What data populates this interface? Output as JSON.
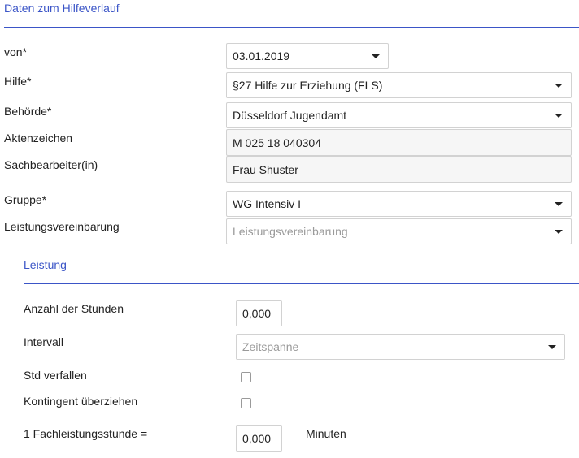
{
  "section": {
    "title": "Daten zum Hilfeverlauf"
  },
  "fields": {
    "von": {
      "label": "von*",
      "value": "03.01.2019"
    },
    "hilfe": {
      "label": "Hilfe*",
      "value": "§27 Hilfe zur Erziehung (FLS)"
    },
    "behoerde": {
      "label": "Behörde*",
      "value": "Düsseldorf Jugendamt"
    },
    "aktenzeichen": {
      "label": "Aktenzeichen",
      "value": "M 025 18 040304"
    },
    "sachbearbeiter": {
      "label": "Sachbearbeiter(in)",
      "value": "Frau Shuster"
    },
    "gruppe": {
      "label": "Gruppe*",
      "value": "WG Intensiv I"
    },
    "leistungsvereinbarung": {
      "label": "Leistungsvereinbarung",
      "placeholder": "Leistungsvereinbarung"
    }
  },
  "leistung": {
    "title": "Leistung",
    "anzahl_stunden": {
      "label": "Anzahl der Stunden",
      "value": "0,000"
    },
    "intervall": {
      "label": "Intervall",
      "placeholder": "Zeitspanne"
    },
    "std_verfallen": {
      "label": "Std verfallen",
      "checked": false
    },
    "kontingent": {
      "label": "Kontingent überziehen",
      "checked": false
    },
    "fachleistungsstunde": {
      "label": "1 Fachleistungsstunde =",
      "value": "0,000",
      "unit": "Minuten"
    }
  },
  "colors": {
    "accent": "#3b55c7",
    "border": "#d2d2d2",
    "placeholder": "#9a9a9a"
  },
  "icons": {
    "dropdown": "chevron-down-icon"
  }
}
